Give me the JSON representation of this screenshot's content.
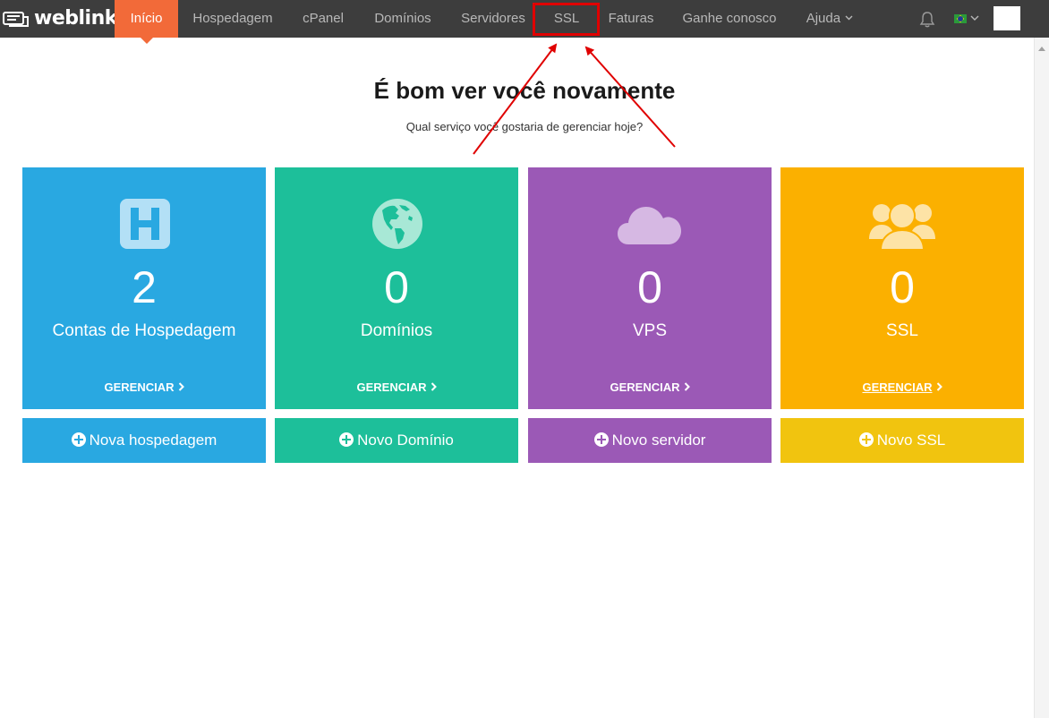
{
  "brand": {
    "name": "weblink"
  },
  "nav": {
    "items": [
      {
        "label": "Início",
        "active": true
      },
      {
        "label": "Hospedagem"
      },
      {
        "label": "cPanel"
      },
      {
        "label": "Domínios"
      },
      {
        "label": "Servidores"
      },
      {
        "label": "SSL",
        "highlighted": true
      },
      {
        "label": "Faturas"
      },
      {
        "label": "Ganhe conosco"
      },
      {
        "label": "Ajuda"
      }
    ],
    "icons": [
      "bell-icon",
      "brazil-flag-icon",
      "chevron-down-icon"
    ]
  },
  "header": {
    "title": "É bom ver você novamente",
    "subtitle": "Qual serviço você gostaria de gerenciar hoje?"
  },
  "cards": [
    {
      "count": "2",
      "label": "Contas de Hospedagem",
      "manage": "GERENCIAR",
      "icon": "hosting-h-icon",
      "color": "#29a8e1",
      "action": "Nova hospedagem",
      "action_color": "#29a8e1"
    },
    {
      "count": "0",
      "label": "Domínios",
      "manage": "GERENCIAR",
      "icon": "globe-icon",
      "color": "#1dbf9a",
      "action": "Novo Domínio",
      "action_color": "#1dbf9a"
    },
    {
      "count": "0",
      "label": "VPS",
      "manage": "GERENCIAR",
      "icon": "cloud-icon",
      "color": "#9b59b6",
      "action": "Novo servidor",
      "action_color": "#9b59b6"
    },
    {
      "count": "0",
      "label": "SSL",
      "manage": "GERENCIAR",
      "icon": "users-icon",
      "color": "#fbb000",
      "action": "Novo SSL",
      "action_color": "#f1c40f"
    }
  ],
  "annotation": {
    "highlight_color": "#e00000"
  }
}
